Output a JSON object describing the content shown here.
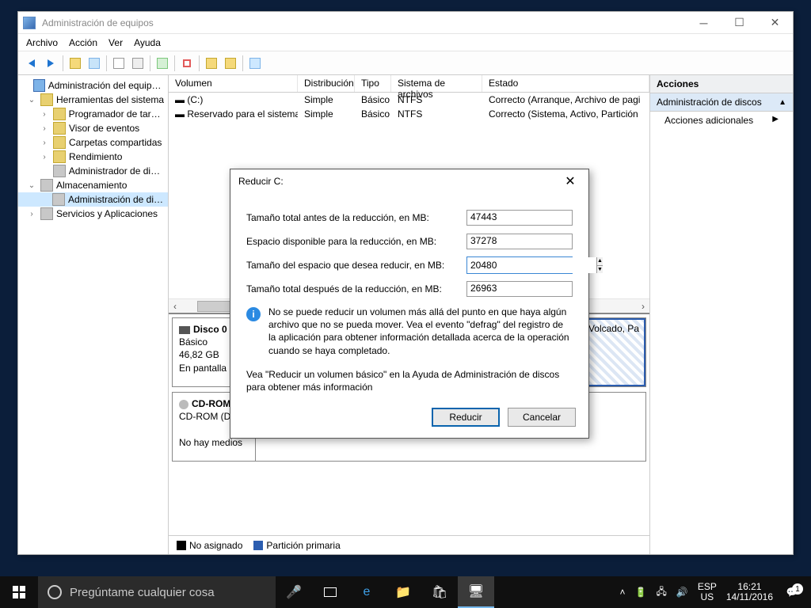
{
  "window": {
    "title": "Administración de equipos",
    "menu": [
      "Archivo",
      "Acción",
      "Ver",
      "Ayuda"
    ]
  },
  "tree": {
    "root": "Administración del equipo (loc",
    "tools": "Herramientas del sistema",
    "sched": "Programador de tareas",
    "event": "Visor de eventos",
    "shared": "Carpetas compartidas",
    "perf": "Rendimiento",
    "devmgr": "Administrador de dispo",
    "storage": "Almacenamiento",
    "diskmgmt": "Administración de disco",
    "svc": "Servicios y Aplicaciones"
  },
  "vol_headers": {
    "vol": "Volumen",
    "dist": "Distribución",
    "type": "Tipo",
    "fs": "Sistema de archivos",
    "st": "Estado"
  },
  "vols": [
    {
      "name": "(C:)",
      "dist": "Simple",
      "type": "Básico",
      "fs": "NTFS",
      "st": "Correcto (Arranque, Archivo de pagi"
    },
    {
      "name": "Reservado para el sistema",
      "dist": "Simple",
      "type": "Básico",
      "fs": "NTFS",
      "st": "Correcto (Sistema, Activo, Partición"
    }
  ],
  "disk0": {
    "title": "Disco 0",
    "type": "Básico",
    "size": "46,82 GB",
    "status": "En pantalla"
  },
  "part_tail": "Volcado, Pa",
  "cdrom": {
    "title": "CD-ROM 0",
    "sub": "CD-ROM (D:)",
    "empty": "No hay medios"
  },
  "legend": {
    "unalloc": "No asignado",
    "primary": "Partición primaria"
  },
  "actions": {
    "header": "Acciones",
    "section": "Administración de discos",
    "more": "Acciones adicionales"
  },
  "dialog": {
    "title": "Reducir C:",
    "l_total_before": "Tamaño total antes de la reducción, en MB:",
    "v_total_before": "47443",
    "l_avail": "Espacio disponible para la reducción, en MB:",
    "v_avail": "37278",
    "l_shrink": "Tamaño del espacio que desea reducir, en MB:",
    "v_shrink": "20480",
    "l_after": "Tamaño total después de la reducción, en MB:",
    "v_after": "26963",
    "info": "No se puede reducir un volumen más allá del punto en que haya algún archivo que no se pueda mover. Vea el evento \"defrag\" del registro de la aplicación para obtener información detallada acerca de la operación cuando se haya completado.",
    "help": "Vea \"Reducir un volumen básico\"  en la Ayuda de Administración de discos para obtener más información",
    "btn_ok": "Reducir",
    "btn_cancel": "Cancelar"
  },
  "taskbar": {
    "search": "Pregúntame cualquier cosa",
    "lang1": "ESP",
    "lang2": "US",
    "time": "16:21",
    "date": "14/11/2016",
    "notif": "1"
  }
}
